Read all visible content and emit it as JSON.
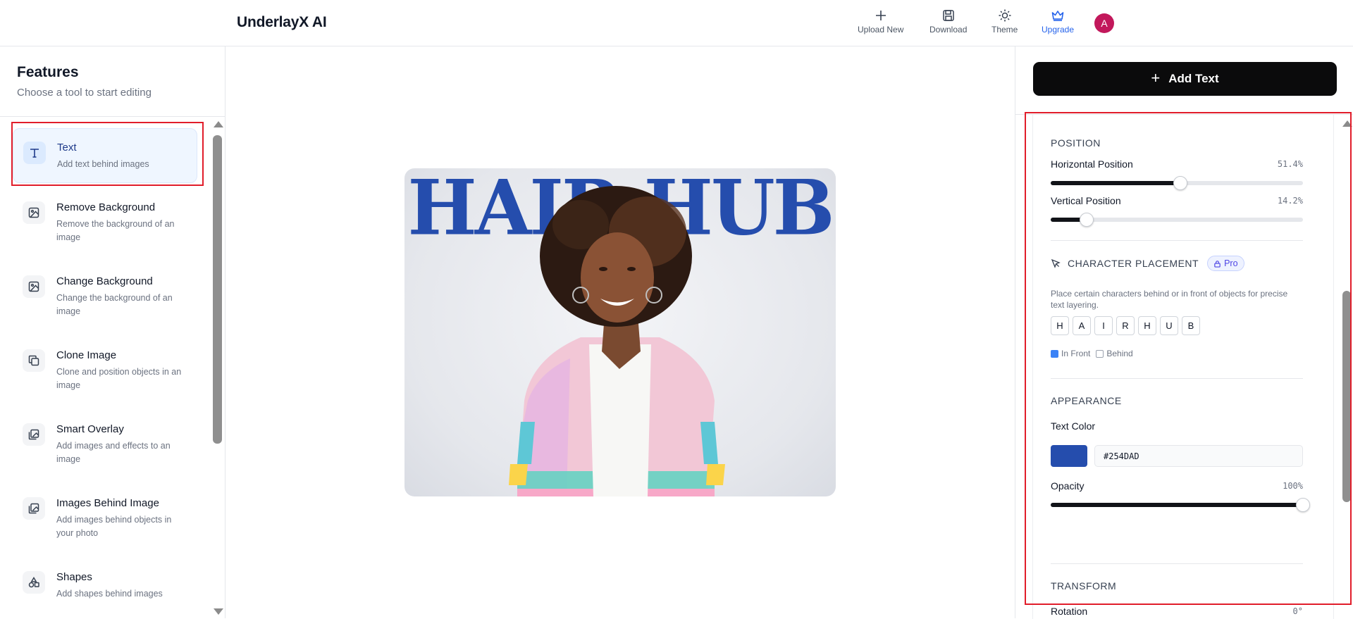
{
  "header": {
    "title": "UnderlayX AI",
    "actions": [
      {
        "label": "Upload New",
        "icon": "plus-icon"
      },
      {
        "label": "Download",
        "icon": "save-icon"
      },
      {
        "label": "Theme",
        "icon": "sun-icon"
      },
      {
        "label": "Upgrade",
        "icon": "crown-icon"
      }
    ],
    "avatar_initial": "A"
  },
  "sidebar": {
    "title": "Features",
    "subtitle": "Choose a tool to start editing",
    "items": [
      {
        "name": "Text",
        "desc": "Add text behind images",
        "icon": "text-icon",
        "active": true
      },
      {
        "name": "Remove Background",
        "desc": "Remove the background of an image",
        "icon": "image-icon"
      },
      {
        "name": "Change Background",
        "desc": "Change the background of an image",
        "icon": "image-icon"
      },
      {
        "name": "Clone Image",
        "desc": "Clone and position objects in an image",
        "icon": "copy-icon"
      },
      {
        "name": "Smart Overlay",
        "desc": "Add images and effects to an image",
        "icon": "images-icon"
      },
      {
        "name": "Images Behind Image",
        "desc": "Add images behind objects in your photo",
        "icon": "images-icon"
      },
      {
        "name": "Shapes",
        "desc": "Add shapes behind images",
        "icon": "shapes-icon"
      }
    ]
  },
  "canvas": {
    "overlay_text": "HAIR HUB",
    "text_color": "#254DAD"
  },
  "panel": {
    "add_text_label": "Add Text",
    "position": {
      "heading": "POSITION",
      "horizontal": {
        "label": "Horizontal Position",
        "value_text": "51.4%",
        "value": 51.4
      },
      "vertical": {
        "label": "Vertical Position",
        "value_text": "14.2%",
        "value": 14.2
      }
    },
    "character_placement": {
      "heading": "CHARACTER PLACEMENT",
      "badge": "Pro",
      "description": "Place certain characters behind or in front of objects for precise text layering.",
      "characters": [
        "H",
        "A",
        "I",
        "R",
        "H",
        "U",
        "B"
      ],
      "legend_front": "In Front",
      "legend_behind": "Behind"
    },
    "appearance": {
      "heading": "APPEARANCE",
      "text_color_label": "Text Color",
      "text_color_value": "#254DAD",
      "opacity": {
        "label": "Opacity",
        "value_text": "100%",
        "value": 100
      }
    },
    "transform": {
      "heading": "TRANSFORM",
      "rotation": {
        "label": "Rotation",
        "value_text": "0°",
        "value": 50
      }
    }
  }
}
